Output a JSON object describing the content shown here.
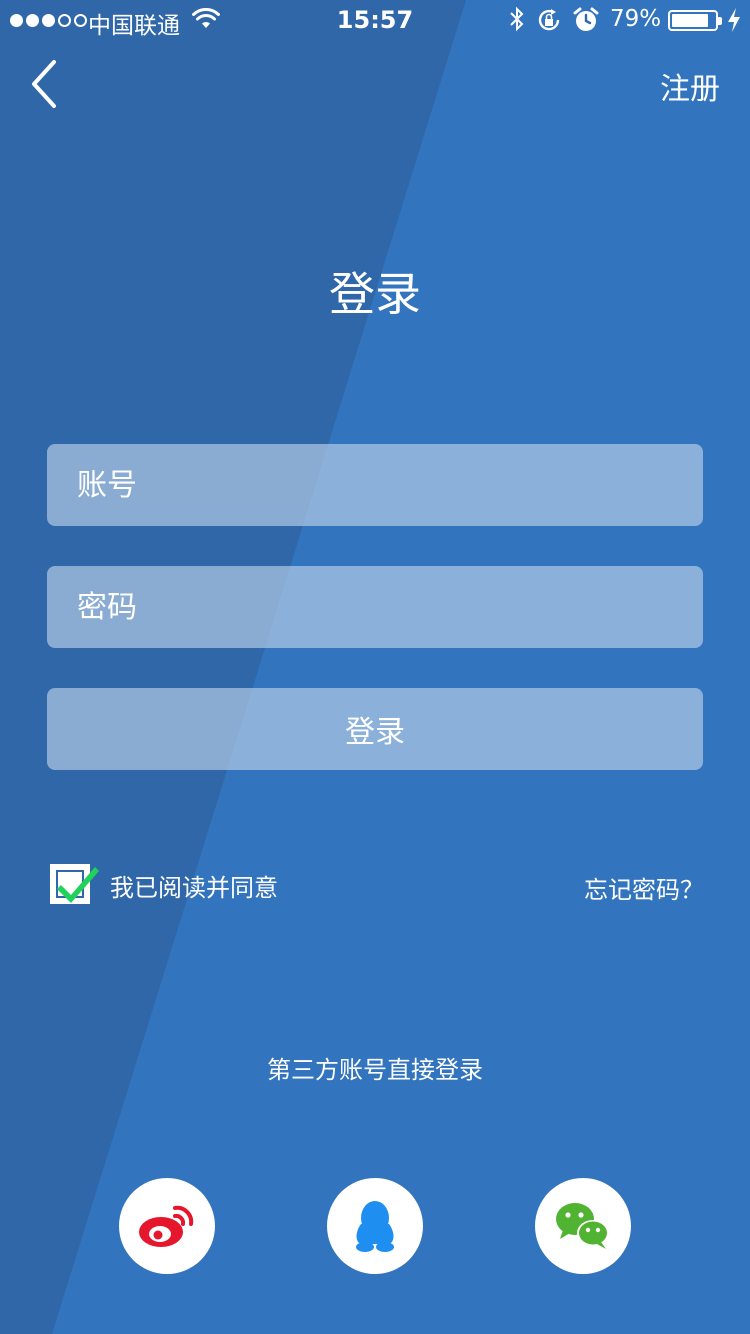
{
  "status_bar": {
    "carrier": "中国联通",
    "time": "15:57",
    "battery_percent": "79%",
    "battery_level": 0.79,
    "signal_strength": 3,
    "signal_max": 5
  },
  "nav": {
    "back_icon": "chevron-left-icon",
    "register_label": "注册"
  },
  "title": "登录",
  "form": {
    "account_placeholder": "账号",
    "password_placeholder": "密码",
    "account_value": "",
    "password_value": "",
    "login_label": "登录"
  },
  "agreement": {
    "checked": true,
    "label": "我已阅读并同意",
    "forgot_label": "忘记密码？"
  },
  "third_party": {
    "label": "第三方账号直接登录",
    "providers": [
      {
        "name": "weibo-icon",
        "color": "#e6162d"
      },
      {
        "name": "qq-icon",
        "color": "#1e8ff0"
      },
      {
        "name": "wechat-icon",
        "color": "#51b332"
      }
    ]
  },
  "colors": {
    "background": "#3274bd",
    "background_dark": "#2f67a8",
    "checkmark": "#1fd25a"
  }
}
